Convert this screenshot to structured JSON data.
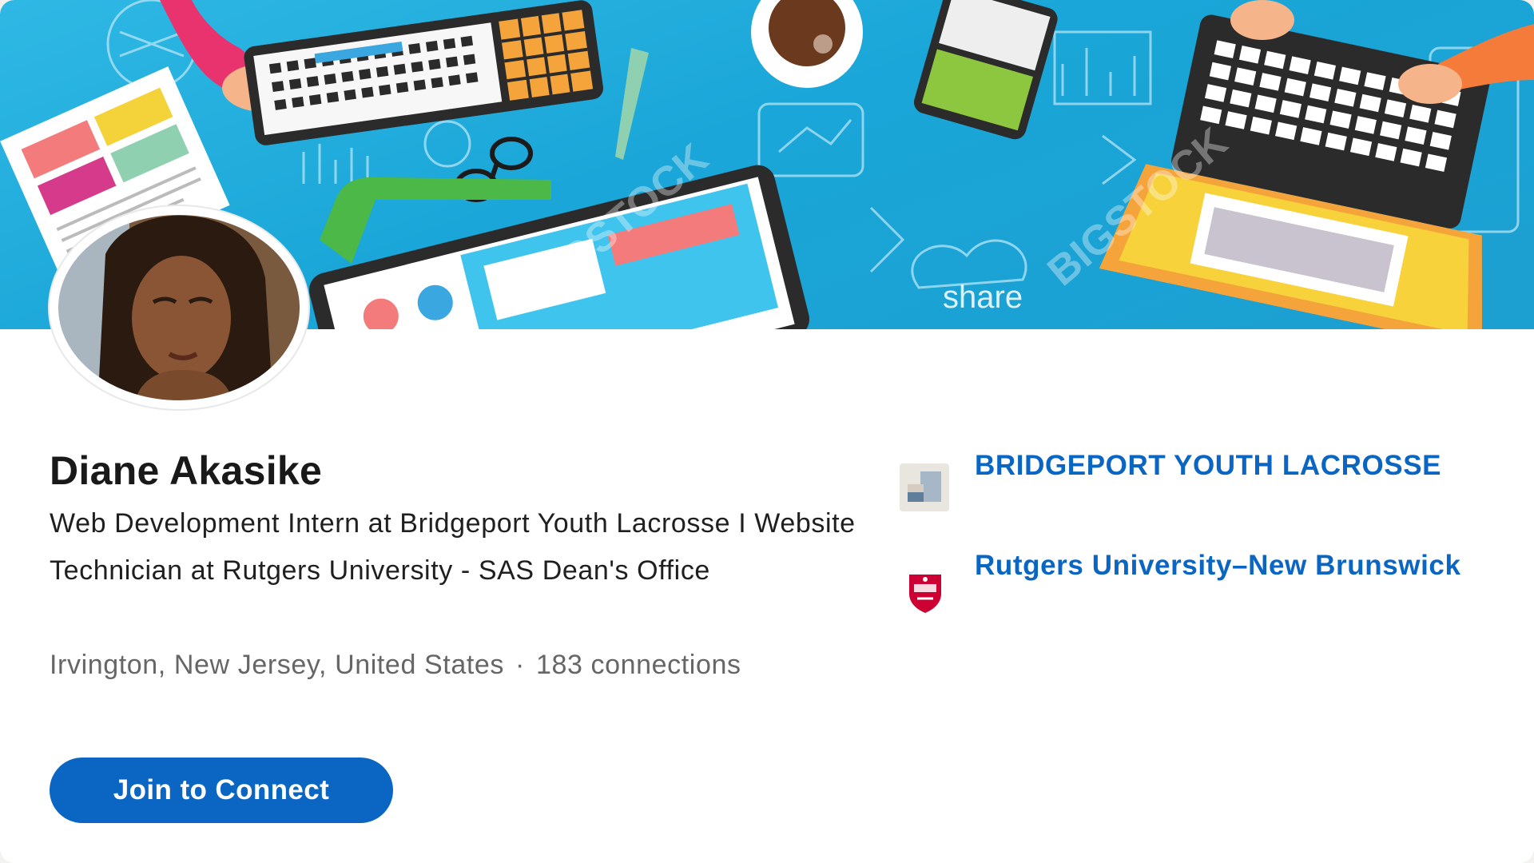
{
  "profile": {
    "name": "Diane Akasike",
    "headline": "Web Development Intern at Bridgeport Youth Lacrosse I Website Technician at Rutgers University - SAS Dean's Office",
    "location": "Irvington, New Jersey, United States",
    "separator": "·",
    "connections": "183 connections"
  },
  "actions": {
    "join_label": "Join to Connect"
  },
  "organizations": [
    {
      "name": "BRIDGEPORT YOUTH LACROSSE",
      "icon": "company-logo-icon"
    },
    {
      "name": "Rutgers University–New Brunswick",
      "icon": "rutgers-shield-icon"
    }
  ],
  "cover": {
    "watermark": "BIGSTOCK",
    "doodle_text": "share"
  },
  "colors": {
    "brand_blue": "#0a66c2",
    "cover_blue": "#1aa6d8",
    "rutgers_red": "#cc0033"
  }
}
